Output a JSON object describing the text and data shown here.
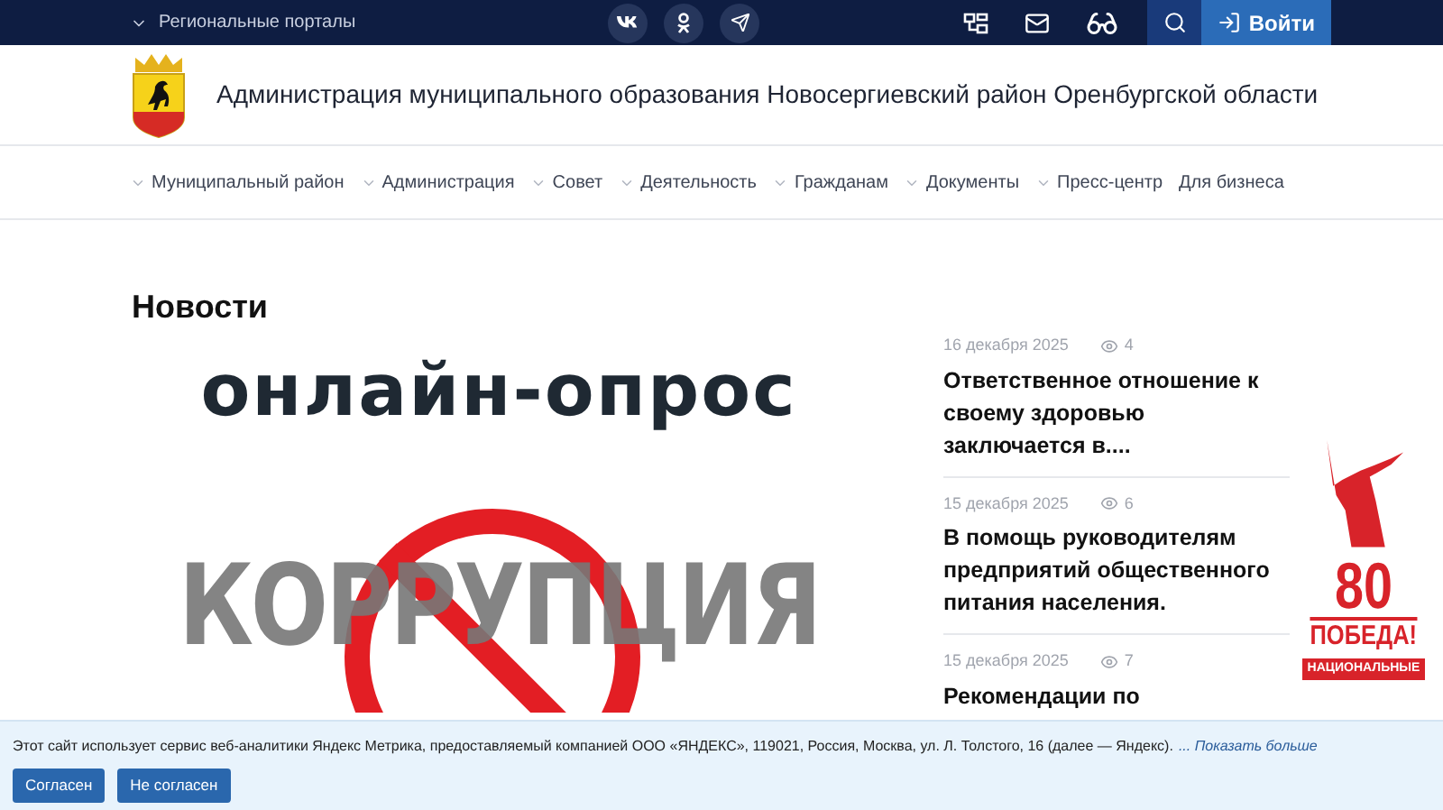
{
  "topbar": {
    "portals": "Региональные порталы",
    "social": [
      {
        "kind": "vk"
      },
      {
        "kind": "ok"
      },
      {
        "kind": "telegram"
      }
    ],
    "login": "Войти"
  },
  "header": {
    "title": "Администрация муниципального образования Новосергиевский район Оренбургской области"
  },
  "nav": [
    {
      "label": "Муниципальный район",
      "dropdown": true
    },
    {
      "label": "Администрация",
      "dropdown": true
    },
    {
      "label": "Совет",
      "dropdown": true
    },
    {
      "label": "Деятельность",
      "dropdown": true
    },
    {
      "label": "Гражданам",
      "dropdown": true
    },
    {
      "label": "Документы",
      "dropdown": true
    },
    {
      "label": "Пресс-центр",
      "dropdown": true
    },
    {
      "label": "Для бизнеса",
      "dropdown": false
    }
  ],
  "news": {
    "heading": "Новости",
    "featured_image": {
      "headline": "онлайн-опрос",
      "caption": "КОРРУПЦИЯ"
    },
    "items": [
      {
        "date": "16 декабря 2025",
        "views": "4",
        "title": "Ответственное отношение к своему здоровью заключается в...."
      },
      {
        "date": "15 декабря 2025",
        "views": "6",
        "title": "В помощь руководителям предприятий общественного питания населения."
      },
      {
        "date": "15 декабря 2025",
        "views": "7",
        "title": "Рекомендации по"
      }
    ]
  },
  "victory_widget": {
    "number": "80",
    "slogan": "ПОБЕДА!",
    "badge": "НАЦИОНАЛЬНЫЕ"
  },
  "cookie_banner": {
    "text": "Этот сайт использует сервис веб-аналитики Яндекс Метрика, предоставляемый компанией ООО «ЯНДЕКС», 119021, Россия, Москва, ул. Л. Толстого, 16 (далее — Яндекс).",
    "more": "... Показать больше",
    "buttons": [
      "Согласен",
      "Не согласен"
    ]
  }
}
